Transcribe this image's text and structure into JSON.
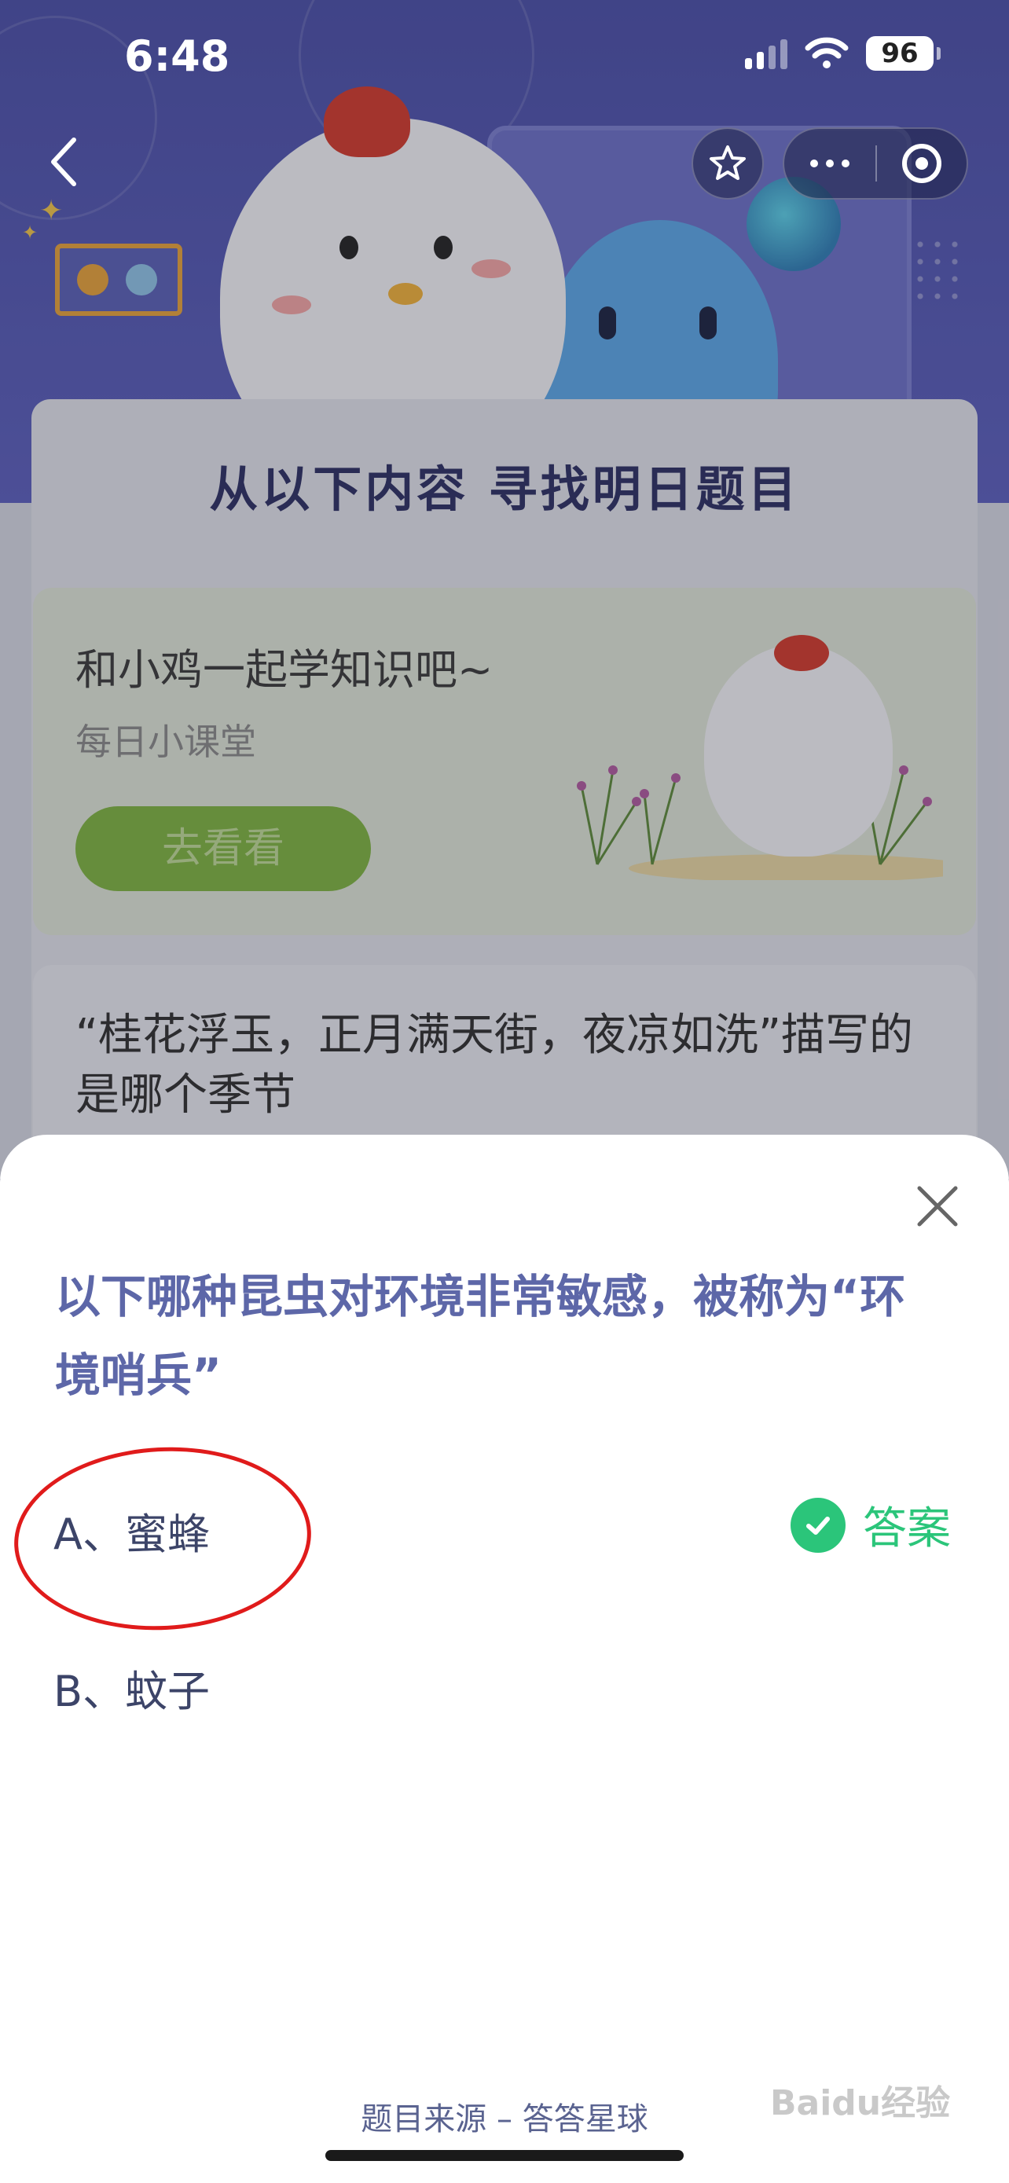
{
  "status_bar": {
    "time": "6:48",
    "battery": "96"
  },
  "background": {
    "section_title": "从以下内容  寻找明日题目",
    "learn_card": {
      "title": "和小鸡一起学知识吧~",
      "subtitle": "每日小课堂",
      "button": "去看看"
    },
    "question_card": {
      "text": "“桂花浮玉，正月满天街，夜凉如洗”描写的是哪个季节"
    }
  },
  "sheet": {
    "question": "以下哪种昆虫对环境非常敏感，被称为“环境哨兵”",
    "options": [
      {
        "label": "A、蜜蜂",
        "is_answer": true
      },
      {
        "label": "B、蚊子",
        "is_answer": false
      }
    ],
    "answer_label": "答案",
    "source": "题目来源 – 答答星球"
  },
  "watermark": "Baidu经验",
  "colors": {
    "answer_green": "#2bc57a",
    "question_blue": "#5d67a8",
    "annotation_red": "#e01b1b"
  }
}
